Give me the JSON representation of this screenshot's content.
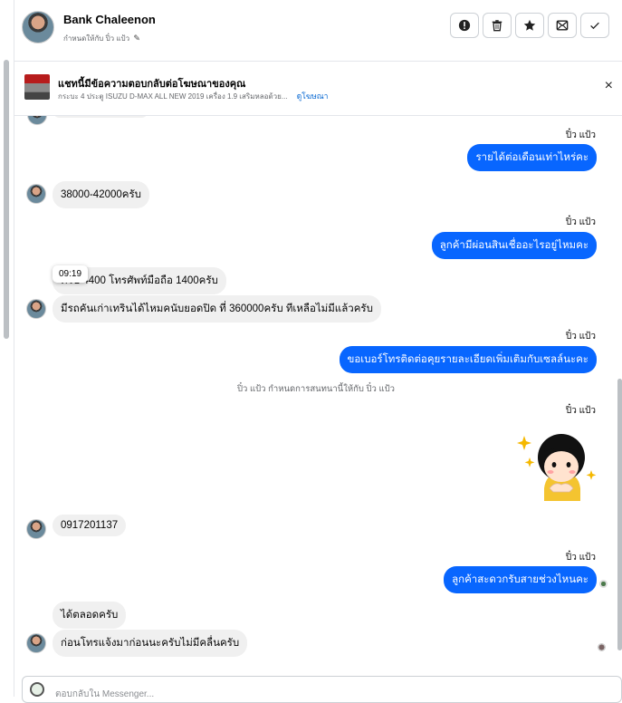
{
  "header": {
    "name": "Bank Chaleenon",
    "assigned_to": "กำหนดให้กับ ปิ๋ว แป้ว",
    "actions": [
      "alert-icon",
      "trash-icon",
      "star-icon",
      "mark-unread-icon",
      "check-icon"
    ]
  },
  "ad": {
    "title": "แชทนี้มีข้อความตอบกลับต่อโฆษณาของคุณ",
    "description": "กระบะ 4 ประตู ISUZU D-MAX ALL NEW 2019 เครื่อง 1.9 เสริมหลอด้วย...",
    "link": "ดูโฆษณา",
    "close": "×"
  },
  "messages": {
    "s1": "ปิ๋ว แป้ว",
    "m1": "รายได้ต่อเดือนเท่าไหร่คะ",
    "r1": "38000-42000ครับ",
    "s2": "ปิ๋ว แป้ว",
    "m2": "ลูกค้ามีผ่อนสินเชื่ออะไรอยู่ไหมคะ",
    "r2": "ครับ 4400 โทรศัพท์มือถือ 1400ครับ",
    "tooltip": "09:19",
    "r3": "มีรถคันเก่าเทรินได้ไหมคนับยอดปิด ที่ 360000ครับ ทีเหลือไม่มีแล้วครับ",
    "s3": "ปิ๋ว แป้ว",
    "m3": "ขอเบอร์โทรติดต่อคุยรายละเอียดเพิ่มเติมกับเซลล์นะคะ",
    "system": "ปิ๋ว แป้ว กำหนดการสนทนานี้ให้กับ ปิ๋ว แป้ว",
    "s4": "ปิ๋ว แป้ว",
    "r4": "0917201137",
    "s5": "ปิ๋ว แป้ว",
    "m5": "ลูกค้าสะดวกรับสายช่วงไหนคะ",
    "r5": "ได้ตลอดครับ",
    "r6": "ก่อนโทรแจ้งมาก่อนนะครับไม่มีคลื่นครับ"
  },
  "composer": {
    "placeholder": "ตอบกลับใน Messenger..."
  },
  "colors": {
    "outgoing": "#0866ff",
    "incoming": "#f0f0f0",
    "link": "#0064d1"
  }
}
